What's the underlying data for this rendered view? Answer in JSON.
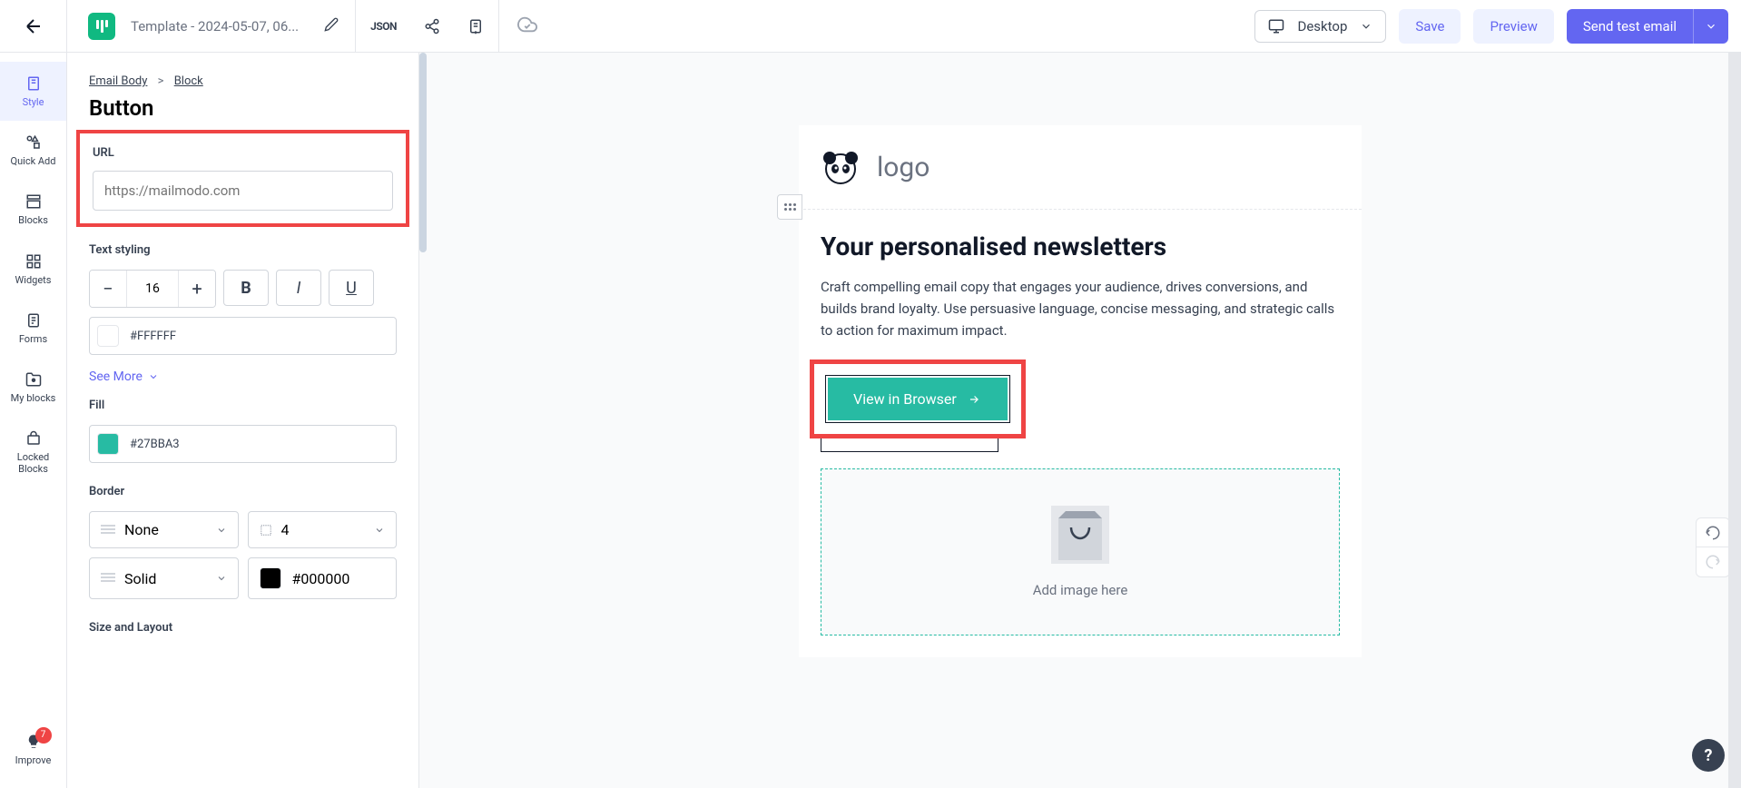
{
  "header": {
    "template_name": "Template - 2024-05-07, 06...",
    "json_btn": "JSON",
    "desktop_label": "Desktop",
    "save_label": "Save",
    "preview_label": "Preview",
    "send_label": "Send test email"
  },
  "leftnav": {
    "style": "Style",
    "quickadd": "Quick Add",
    "blocks": "Blocks",
    "widgets": "Widgets",
    "forms": "Forms",
    "myblocks": "My blocks",
    "lockedblocks": "Locked Blocks",
    "improve": "Improve",
    "improve_count": "7"
  },
  "panel": {
    "breadcrumb_root": "Email Body",
    "breadcrumb_leaf": "Block",
    "title": "Button",
    "url_label": "URL",
    "url_placeholder": "https://mailmodo.com",
    "text_styling_label": "Text styling",
    "font_size": "16",
    "text_color": "#FFFFFF",
    "see_more": "See More",
    "fill_label": "Fill",
    "fill_color": "#27BBA3",
    "border_label": "Border",
    "border_style_none": "None",
    "border_radius": "4",
    "border_style_solid": "Solid",
    "border_color": "#000000",
    "size_layout_label": "Size and Layout"
  },
  "email": {
    "logo_text": "logo",
    "title": "Your personalised newsletters",
    "body": "Craft compelling email copy that engages your audience, drives conversions, and builds brand loyalty. Use persuasive language, concise messaging, and strategic calls to action for maximum impact.",
    "button_label": "View in Browser",
    "add_image": "Add image here"
  },
  "colors": {
    "accent": "#6366f1",
    "teal": "#27BBA3",
    "highlight": "#ef4444"
  }
}
